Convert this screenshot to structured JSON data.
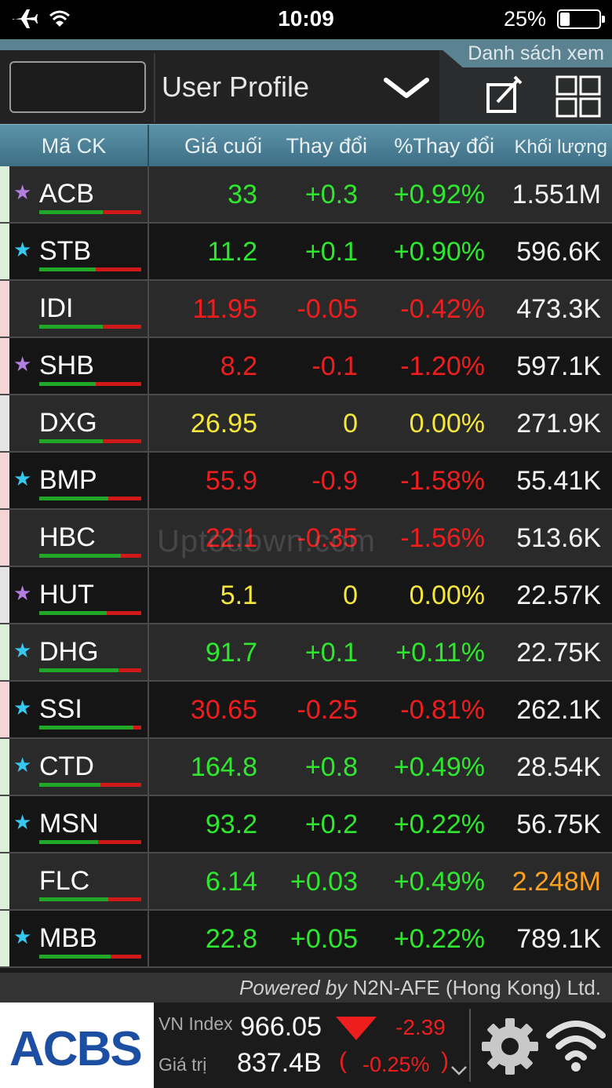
{
  "status_bar": {
    "time": "10:09",
    "battery": "25%",
    "battery_level": 0.25
  },
  "header": {
    "tab_label": "Danh sách xem",
    "profile_label": "User Profile",
    "search_value": ""
  },
  "columns": {
    "code": "Mã CK",
    "last": "Giá cuối",
    "change": "Thay đổi",
    "pct": "%Thay đổi",
    "volume": "Khối lượng"
  },
  "rows": [
    {
      "code": "ACB",
      "star": "purple",
      "stripe": "green",
      "last": "33",
      "change": "+0.3",
      "pct": "+0.92%",
      "volume": "1.551M",
      "trend": "up",
      "vol_color": "white",
      "bar_green_ratio": 0.62
    },
    {
      "code": "STB",
      "star": "cyan",
      "stripe": "green",
      "last": "11.2",
      "change": "+0.1",
      "pct": "+0.90%",
      "volume": "596.6K",
      "trend": "up",
      "vol_color": "white",
      "bar_green_ratio": 0.55
    },
    {
      "code": "IDI",
      "star": "none",
      "stripe": "red",
      "last": "11.95",
      "change": "-0.05",
      "pct": "-0.42%",
      "volume": "473.3K",
      "trend": "down",
      "vol_color": "white",
      "bar_green_ratio": 0.62
    },
    {
      "code": "SHB",
      "star": "purple",
      "stripe": "red",
      "last": "8.2",
      "change": "-0.1",
      "pct": "-1.20%",
      "volume": "597.1K",
      "trend": "down",
      "vol_color": "white",
      "bar_green_ratio": 0.55
    },
    {
      "code": "DXG",
      "star": "none",
      "stripe": "gray",
      "last": "26.95",
      "change": "0",
      "pct": "0.00%",
      "volume": "271.9K",
      "trend": "flat",
      "vol_color": "white",
      "bar_green_ratio": 0.62
    },
    {
      "code": "BMP",
      "star": "cyan",
      "stripe": "red",
      "last": "55.9",
      "change": "-0.9",
      "pct": "-1.58%",
      "volume": "55.41K",
      "trend": "down",
      "vol_color": "white",
      "bar_green_ratio": 0.68
    },
    {
      "code": "HBC",
      "star": "none",
      "stripe": "red",
      "last": "22.1",
      "change": "-0.35",
      "pct": "-1.56%",
      "volume": "513.6K",
      "trend": "down",
      "vol_color": "white",
      "bar_green_ratio": 0.8
    },
    {
      "code": "HUT",
      "star": "purple",
      "stripe": "gray",
      "last": "5.1",
      "change": "0",
      "pct": "0.00%",
      "volume": "22.57K",
      "trend": "flat",
      "vol_color": "white",
      "bar_green_ratio": 0.66
    },
    {
      "code": "DHG",
      "star": "cyan",
      "stripe": "green",
      "last": "91.7",
      "change": "+0.1",
      "pct": "+0.11%",
      "volume": "22.75K",
      "trend": "up",
      "vol_color": "white",
      "bar_green_ratio": 0.78
    },
    {
      "code": "SSI",
      "star": "cyan",
      "stripe": "red",
      "last": "30.65",
      "change": "-0.25",
      "pct": "-0.81%",
      "volume": "262.1K",
      "trend": "down",
      "vol_color": "white",
      "bar_green_ratio": 0.92
    },
    {
      "code": "CTD",
      "star": "cyan",
      "stripe": "green",
      "last": "164.8",
      "change": "+0.8",
      "pct": "+0.49%",
      "volume": "28.54K",
      "trend": "up",
      "vol_color": "white",
      "bar_green_ratio": 0.6
    },
    {
      "code": "MSN",
      "star": "cyan",
      "stripe": "green",
      "last": "93.2",
      "change": "+0.2",
      "pct": "+0.22%",
      "volume": "56.75K",
      "trend": "up",
      "vol_color": "white",
      "bar_green_ratio": 0.58
    },
    {
      "code": "FLC",
      "star": "none",
      "stripe": "green",
      "last": "6.14",
      "change": "+0.03",
      "pct": "+0.49%",
      "volume": "2.248M",
      "trend": "up",
      "vol_color": "orange",
      "bar_green_ratio": 0.68
    },
    {
      "code": "MBB",
      "star": "cyan",
      "stripe": "green",
      "last": "22.8",
      "change": "+0.05",
      "pct": "+0.22%",
      "volume": "789.1K",
      "trend": "up",
      "vol_color": "white",
      "bar_green_ratio": 0.7
    }
  ],
  "footer": {
    "powered_by": "Powered by",
    "company": "N2N-AFE (Hong Kong) Ltd.",
    "logo": "ACBS",
    "index_label": "VN Index",
    "index_value": "966.05",
    "index_change": "-2.39",
    "value_label": "Giá trị",
    "value": "837.4B",
    "value_open": "(",
    "value_pct": "-0.25%",
    "value_close": ")"
  },
  "watermark": "Uptodown.com",
  "colors": {
    "up": "#2ee82e",
    "down": "#ee1e1e",
    "flat": "#f5e63c",
    "orange": "#ffa11e",
    "header_blue": "#5d94aa",
    "logo_blue": "#1c4fa3",
    "logo_gold": "#f2a60e"
  }
}
